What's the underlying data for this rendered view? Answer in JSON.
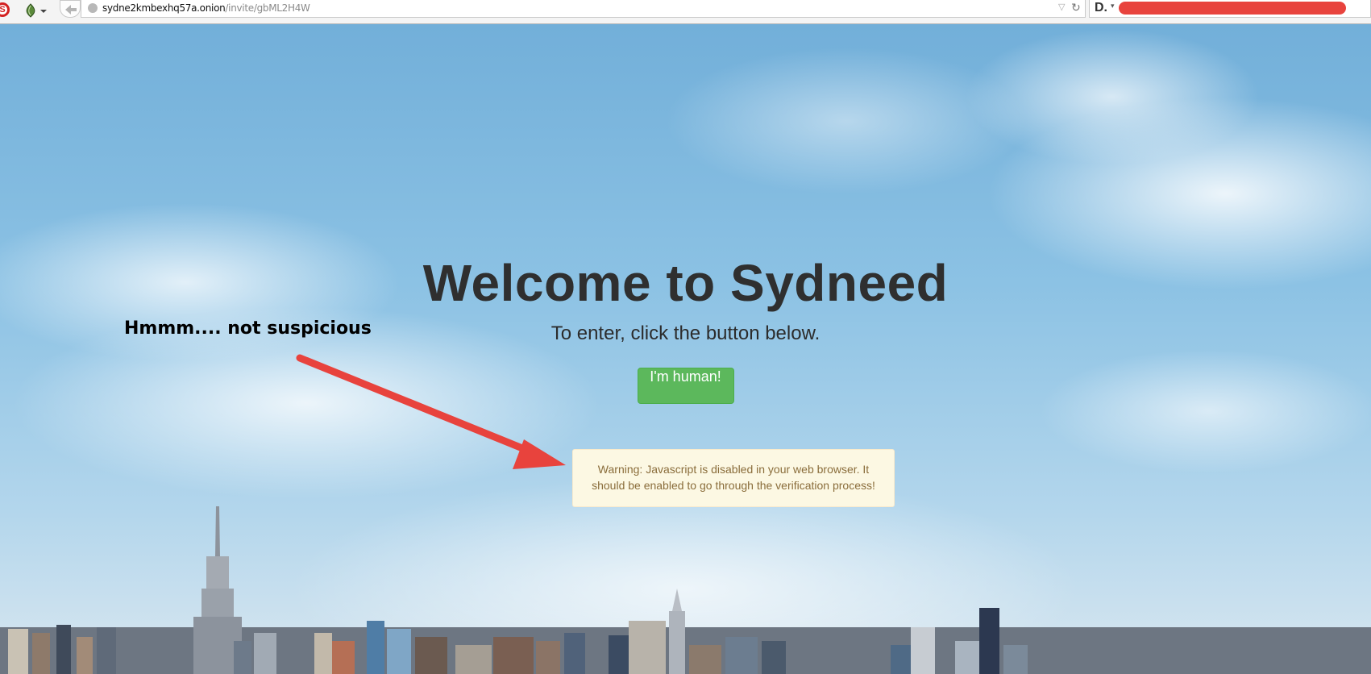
{
  "browser": {
    "tor_icon": "S",
    "url_host": "sydne2kmbexhq57a.onion",
    "url_path": "/invite/gbML2H4W",
    "search_engine_icon": "D.",
    "icons": [
      "tor-s-icon",
      "onion-button-icon",
      "back-arrow-icon",
      "globe-icon",
      "dropdown-icon",
      "reload-icon",
      "duckduckgo-icon"
    ]
  },
  "page": {
    "title": "Welcome to Sydneed",
    "subtitle": "To enter, click the button below.",
    "button_label": "I'm human!",
    "warning": "Warning: Javascript is disabled in your web browser. It should be enabled to go through the verification process!"
  },
  "annotation": {
    "text": "Hmmm.... not suspicious",
    "arrow_color": "#e8433d"
  },
  "colors": {
    "button": "#5cb85c",
    "warning_bg": "#fcf8e3",
    "warning_text": "#8a6d3b",
    "heading": "#2f2f2f"
  }
}
